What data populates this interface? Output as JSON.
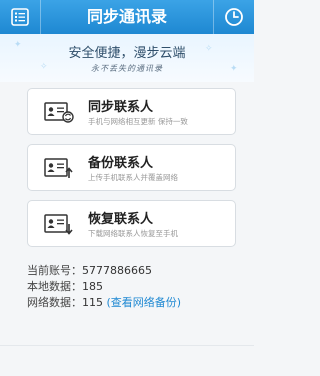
{
  "header": {
    "title": "同步通讯录",
    "menu_icon": "list-icon",
    "history_icon": "clock-icon"
  },
  "banner": {
    "slogan": "安全便捷，漫步云端",
    "script_text": "永不丢失的通讯录"
  },
  "actions": [
    {
      "title": "同步联系人",
      "subtitle": "手机与网络相互更新 保持一致",
      "icon": "contact-sync-icon"
    },
    {
      "title": "备份联系人",
      "subtitle": "上传手机联系人并覆盖网络",
      "icon": "contact-upload-icon"
    },
    {
      "title": "恢复联系人",
      "subtitle": "下载网络联系人恢复至手机",
      "icon": "contact-download-icon"
    }
  ],
  "account": {
    "account_label": "当前账号：",
    "account_value": "5777886665",
    "local_label": "本地数据：",
    "local_value": "185",
    "network_label": "网络数据：",
    "network_value": "115",
    "network_link": "(查看网络备份)"
  },
  "colors": {
    "accent": "#1e88d2",
    "header": "#2b97de"
  }
}
